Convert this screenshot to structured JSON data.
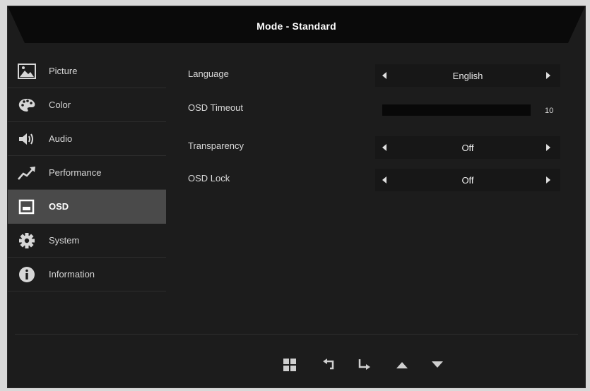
{
  "header": {
    "title": "Mode - Standard"
  },
  "sidebar": {
    "items": [
      {
        "label": "Picture",
        "icon": "picture-icon"
      },
      {
        "label": "Color",
        "icon": "palette-icon"
      },
      {
        "label": "Audio",
        "icon": "speaker-icon"
      },
      {
        "label": "Performance",
        "icon": "performance-icon"
      },
      {
        "label": "OSD",
        "icon": "osd-icon",
        "active": true
      },
      {
        "label": "System",
        "icon": "gear-icon"
      },
      {
        "label": "Information",
        "icon": "info-icon"
      }
    ]
  },
  "settings": {
    "language": {
      "label": "Language",
      "value": "English"
    },
    "osd_timeout": {
      "label": "OSD Timeout",
      "value": "10",
      "fraction": 0.0
    },
    "transparency": {
      "label": "Transparency",
      "value": "Off"
    },
    "osd_lock": {
      "label": "OSD Lock",
      "value": "Off"
    }
  },
  "footer": {
    "buttons": [
      "menu-icon",
      "back-icon",
      "enter-icon",
      "up-icon",
      "down-icon"
    ]
  },
  "colors": {
    "background": "#1c1c1c",
    "active_item": "#4a4a4a",
    "text": "#d9d9d9"
  }
}
